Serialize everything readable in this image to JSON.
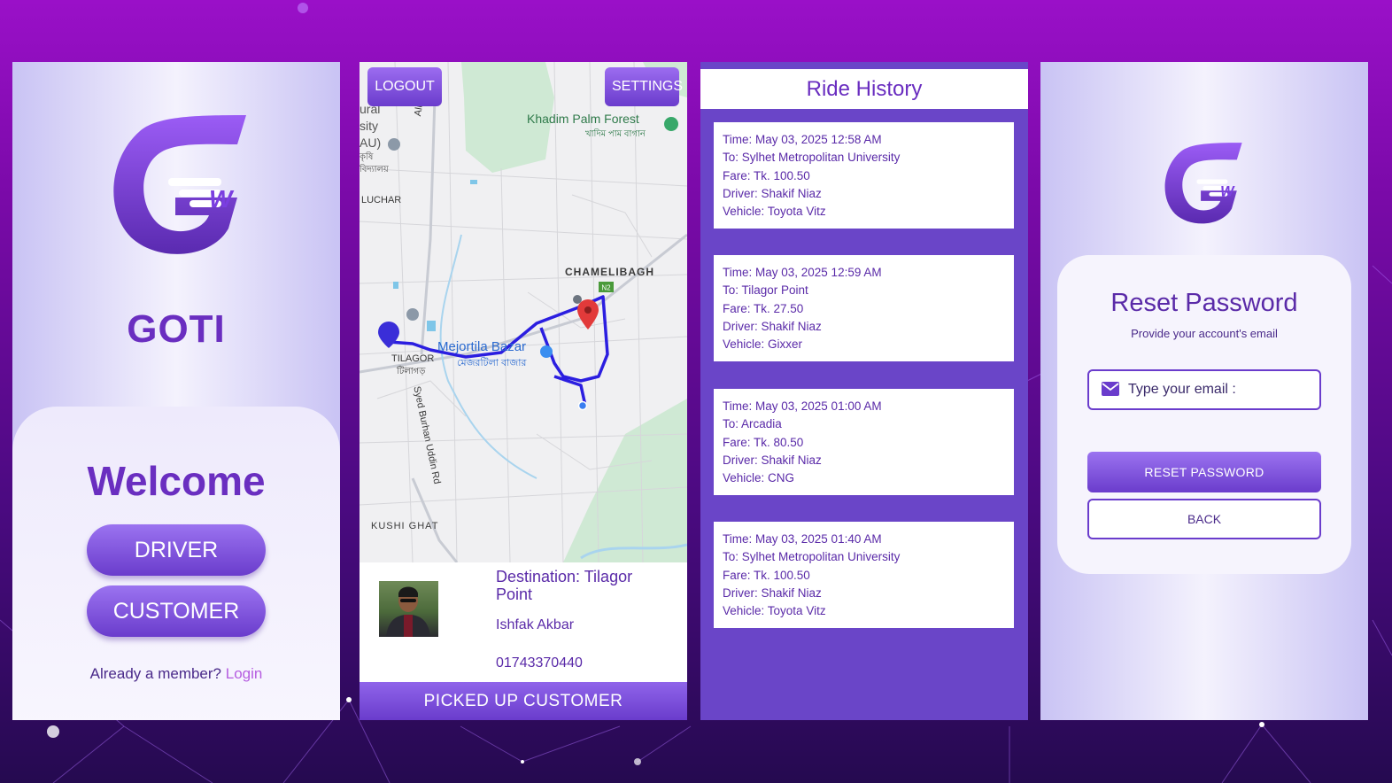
{
  "colors": {
    "accent": "#6a3ccc",
    "brand_text": "#6a2ec0",
    "background": "#7a0aa8"
  },
  "welcome_screen": {
    "logo_icon": "goti-logo-icon",
    "brand": "GOTI",
    "welcome": "Welcome",
    "driver_label": "DRIVER",
    "customer_label": "CUSTOMER",
    "member_text": "Already a member?",
    "login_link": "Login"
  },
  "map_screen": {
    "logout_label": "LOGOUT",
    "settings_label": "SETTINGS",
    "map_labels": {
      "khadim_forest": "Khadim Palm Forest",
      "khadim_forest_bn": "খাদিম পাম বাগান",
      "chamelibagh": "CHAMELIBAGH",
      "mejortila": "Mejortila Bazar",
      "mejortila_bn": "মেজরটিলা বাজার",
      "tilagor": "TILAGOR",
      "tilagor_bn": "টিলাগড়",
      "kushi_ghat": "KUSHI GHAT",
      "luchar": "LUCHAR",
      "alurtol_road": "Alurtol Rd",
      "syed_burhan_road": "Syed Burhan Uddin Rd",
      "n2": "N2",
      "partial_rural": "ural",
      "partial_sity": "sity",
      "partial_au": "AU)",
      "partial_bn1": "কৃষি",
      "partial_bn2": "বিদ্যালয়"
    },
    "destination": "Destination: Tilagor Point",
    "customer_name": "Ishfak Akbar",
    "customer_phone": "01743370440",
    "pickup_label": "PICKED UP CUSTOMER"
  },
  "history_screen": {
    "title": "Ride History",
    "rides": [
      {
        "time": "Time: May 03, 2025 12:58 AM",
        "to": "To: Sylhet Metropolitan University",
        "fare": "Fare: Tk. 100.50",
        "driver": "Driver: Shakif Niaz",
        "vehicle": "Vehicle: Toyota Vitz"
      },
      {
        "time": "Time: May 03, 2025 12:59 AM",
        "to": "To: Tilagor Point",
        "fare": "Fare: Tk. 27.50",
        "driver": "Driver: Shakif Niaz",
        "vehicle": "Vehicle: Gixxer"
      },
      {
        "time": "Time: May 03, 2025 01:00 AM",
        "to": "To: Arcadia",
        "fare": "Fare: Tk. 80.50",
        "driver": "Driver: Shakif Niaz",
        "vehicle": "Vehicle: CNG"
      },
      {
        "time": "Time: May 03, 2025 01:40 AM",
        "to": "To: Sylhet Metropolitan University",
        "fare": "Fare: Tk. 100.50",
        "driver": "Driver: Shakif Niaz",
        "vehicle": "Vehicle: Toyota Vitz"
      }
    ]
  },
  "reset_screen": {
    "title": "Reset Password",
    "subtitle": "Provide your account's email",
    "email_placeholder": "Type your email :",
    "email_icon": "mail-icon",
    "reset_label": "RESET PASSWORD",
    "back_label": "BACK"
  }
}
